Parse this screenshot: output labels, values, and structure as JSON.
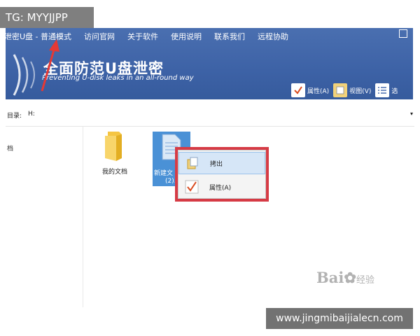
{
  "watermark_tag": "TG: MYYJJPP",
  "menu": {
    "items": [
      "泄密U盘 - 普通模式",
      "访问官网",
      "关于软件",
      "使用说明",
      "联系我们",
      "远程协助"
    ]
  },
  "banner": {
    "title": "全面防范U盘泄密",
    "subtitle": "Preventing U-disk leaks in an all-round way"
  },
  "toolbar": {
    "properties": "属性(A)",
    "view": "视图(V)",
    "select": "选"
  },
  "path_bar": {
    "label": "目录:",
    "value": "H:",
    "dropdown": "▾"
  },
  "sidebar": {
    "item": "档"
  },
  "files": {
    "folder_label": "我的文档",
    "file_label_line1": "新建文",
    "file_label_line2": "(2)."
  },
  "context_menu": {
    "eject": "拷出",
    "properties": "属性(A)"
  },
  "watermarks": {
    "baidu": "Bai",
    "baidu_cn": "经验",
    "url": "www.jingmibaijialecn.com"
  },
  "colors": {
    "header_blue": "#3d62a6",
    "highlight_red": "#d63b45",
    "selection_blue": "#4a91d6",
    "arrow_red": "#e53935"
  },
  "icons": {
    "check": "check-icon",
    "folder": "folder-icon",
    "file": "file-icon",
    "copy": "copy-icon"
  }
}
